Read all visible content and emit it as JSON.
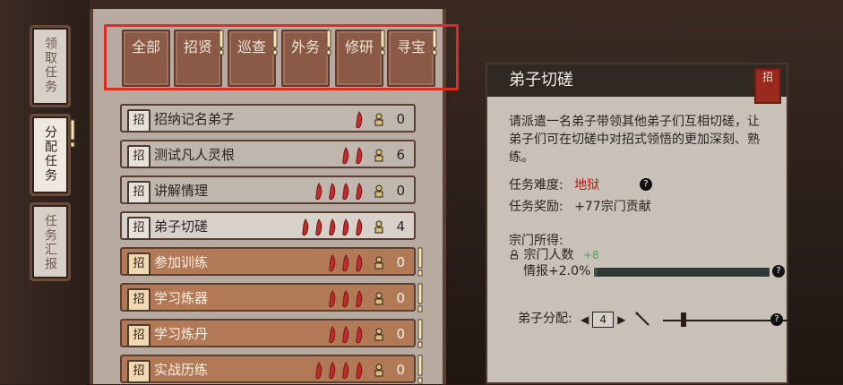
{
  "left_scrolls": [
    {
      "label": "领取任务"
    },
    {
      "label": "分配任务"
    },
    {
      "label": "任务汇报"
    }
  ],
  "tabs": [
    {
      "label": "全部",
      "alert": false
    },
    {
      "label": "招贤",
      "alert": true
    },
    {
      "label": "巡查",
      "alert": true
    },
    {
      "label": "外务",
      "alert": true
    },
    {
      "label": "修研",
      "alert": true
    },
    {
      "label": "寻宝",
      "alert": true
    }
  ],
  "tasks": [
    {
      "icon": "招",
      "name": "招纳记名弟子",
      "peppers": 1,
      "count": "0",
      "style": "gray",
      "alert": false
    },
    {
      "icon": "招",
      "name": "测试凡人灵根",
      "peppers": 2,
      "count": "6",
      "style": "gray",
      "alert": false
    },
    {
      "icon": "招",
      "name": "讲解情理",
      "peppers": 4,
      "count": "0",
      "style": "gray",
      "alert": false
    },
    {
      "icon": "招",
      "name": "弟子切磋",
      "peppers": 5,
      "count": "4",
      "style": "light",
      "alert": false
    },
    {
      "icon": "招",
      "name": "参加训练",
      "peppers": 3,
      "count": "0",
      "style": "orange",
      "alert": true
    },
    {
      "icon": "招",
      "name": "学习炼器",
      "peppers": 3,
      "count": "0",
      "style": "orange",
      "alert": true
    },
    {
      "icon": "招",
      "name": "学习炼丹",
      "peppers": 3,
      "count": "0",
      "style": "orange",
      "alert": true
    },
    {
      "icon": "招",
      "name": "实战历练",
      "peppers": 4,
      "count": "0",
      "style": "orange",
      "alert": true
    }
  ],
  "detail": {
    "title": "弟子切磋",
    "seal": "招",
    "description": "请派遣一名弟子带领其他弟子们互相切磋，让弟子们可在切磋中对招式领悟的更加深刻、熟练。",
    "difficulty_label": "任务难度:",
    "difficulty_value": "地狱",
    "reward_label": "任务奖励:",
    "reward_value": "+77宗门贡献",
    "gain_label": "宗门所得:",
    "gain_people_label": "宗门人数",
    "gain_people_value": "+8",
    "intel_label": "情报+2.0%",
    "intel_progress": 0.02,
    "assign_label": "弟子分配:",
    "assign_value": "4"
  },
  "colors": {
    "highlight_red": "#e22a20",
    "difficulty_red": "#c41414",
    "pepper_red": "#c62a2a",
    "gain_green": "#4fa35a"
  }
}
